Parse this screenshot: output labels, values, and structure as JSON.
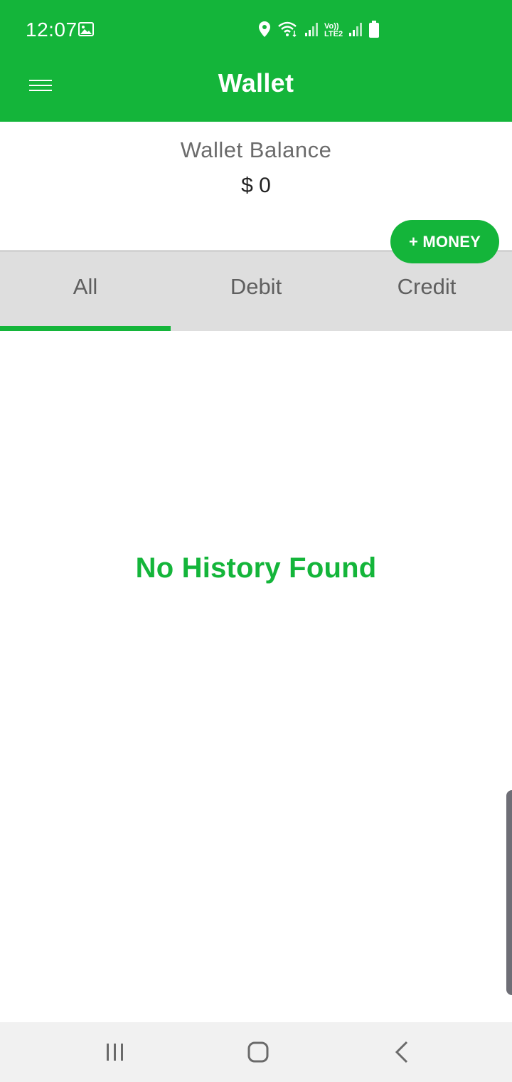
{
  "status": {
    "time": "12:07",
    "icons": [
      "gallery-icon",
      "location-icon",
      "wifi-icon",
      "signal-icon",
      "volte-icon",
      "signal-icon",
      "battery-icon"
    ],
    "volte_top": "Vo))",
    "volte_bottom": "LTE2"
  },
  "appbar": {
    "title": "Wallet",
    "menu_icon": "menu-icon"
  },
  "balance": {
    "label": "Wallet Balance",
    "amount": "$ 0",
    "add_money_label": "+ MONEY"
  },
  "tabs": [
    {
      "label": "All",
      "active": true
    },
    {
      "label": "Debit",
      "active": false
    },
    {
      "label": "Credit",
      "active": false
    }
  ],
  "empty_state": {
    "message": "No History Found"
  },
  "navbar": {
    "icons": [
      "recent-apps-icon",
      "home-icon",
      "back-icon"
    ]
  },
  "colors": {
    "primary": "#14b53a",
    "tab_background": "#dedede",
    "text_muted": "#5f5f5f"
  }
}
